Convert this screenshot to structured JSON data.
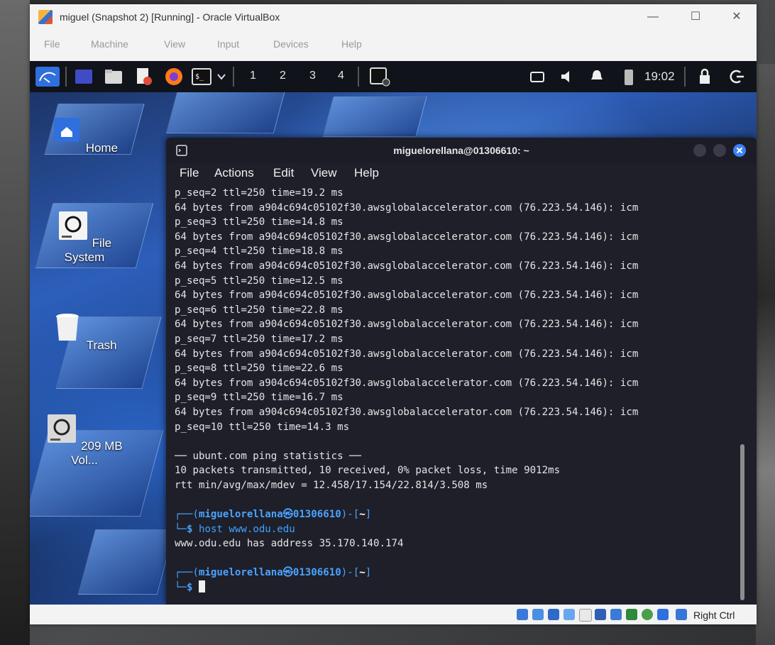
{
  "window": {
    "title": "miguel (Snapshot 2) [Running] - Oracle VirtualBox",
    "minimize": "—",
    "maximize": "☐",
    "close": "✕"
  },
  "menubar": [
    "File",
    "Machine",
    "View",
    "Input",
    "Devices",
    "Help"
  ],
  "panel": {
    "workspaces": [
      "1",
      "2",
      "3",
      "4"
    ],
    "clock": "19:02"
  },
  "desktop": {
    "icons": [
      {
        "label": "Home",
        "icon": "home-icon"
      },
      {
        "label": "File System",
        "icon": "drive-icon"
      },
      {
        "label": "Trash",
        "icon": "trash-icon"
      },
      {
        "label": "209 MB Vol...",
        "icon": "volume-icon"
      }
    ]
  },
  "terminal": {
    "title": "miguelorellana@01306610: ~",
    "menu": [
      "File",
      "Actions",
      "Edit",
      "View",
      "Help"
    ],
    "output_lines": [
      "p_seq=2 ttl=250 time=19.2 ms",
      "64 bytes from a904c694c05102f30.awsglobalaccelerator.com (76.223.54.146): icm",
      "p_seq=3 ttl=250 time=14.8 ms",
      "64 bytes from a904c694c05102f30.awsglobalaccelerator.com (76.223.54.146): icm",
      "p_seq=4 ttl=250 time=18.8 ms",
      "64 bytes from a904c694c05102f30.awsglobalaccelerator.com (76.223.54.146): icm",
      "p_seq=5 ttl=250 time=12.5 ms",
      "64 bytes from a904c694c05102f30.awsglobalaccelerator.com (76.223.54.146): icm",
      "p_seq=6 ttl=250 time=22.8 ms",
      "64 bytes from a904c694c05102f30.awsglobalaccelerator.com (76.223.54.146): icm",
      "p_seq=7 ttl=250 time=17.2 ms",
      "64 bytes from a904c694c05102f30.awsglobalaccelerator.com (76.223.54.146): icm",
      "p_seq=8 ttl=250 time=22.6 ms",
      "64 bytes from a904c694c05102f30.awsglobalaccelerator.com (76.223.54.146): icm",
      "p_seq=9 ttl=250 time=16.7 ms",
      "64 bytes from a904c694c05102f30.awsglobalaccelerator.com (76.223.54.146): icm",
      "p_seq=10 ttl=250 time=14.3 ms",
      "",
      "── ubunt.com ping statistics ──",
      "10 packets transmitted, 10 received, 0% packet loss, time 9012ms",
      "rtt min/avg/max/mdev = 12.458/17.154/22.814/3.508 ms",
      ""
    ],
    "prompt_user": "miguelorellana㉿01306610",
    "prompt_dir": "~",
    "command": "host www.odu.edu",
    "command_output": "www.odu.edu has address 35.170.140.174"
  },
  "statusbar": {
    "host_key": "Right Ctrl"
  },
  "colors": {
    "prompt": "#4aa3ff",
    "terminal_bg": "#1e1f29",
    "close_button": "#3b82f6"
  }
}
